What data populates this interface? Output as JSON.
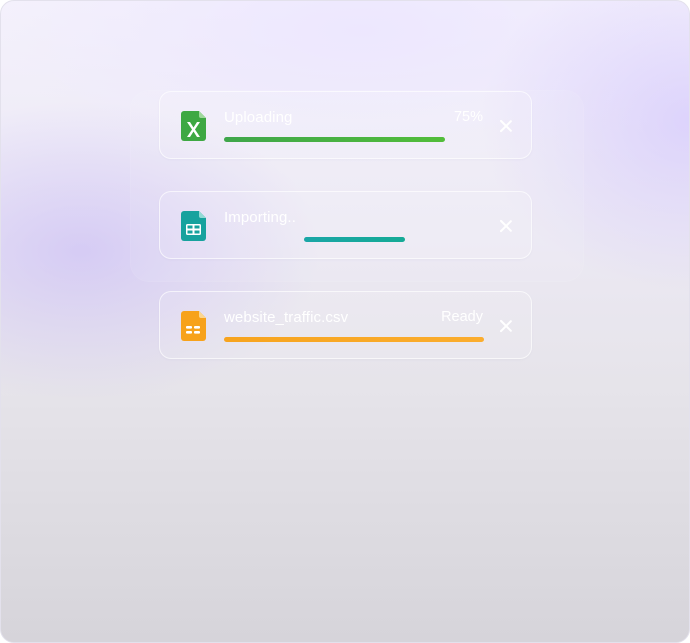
{
  "uploads": [
    {
      "file_icon": "excel-file-icon",
      "title": "Uploading",
      "status": "75%",
      "progress": 0.85,
      "accent": "#46b345"
    },
    {
      "file_icon": "sheets-file-icon",
      "title": "Importing..",
      "status": "",
      "progress": 0.38,
      "progress_offset": 0.31,
      "accent": "#18aaa3"
    },
    {
      "file_icon": "csv-file-icon",
      "title": "website_traffic.csv",
      "status": "Ready",
      "progress": 1.0,
      "accent": "#f9a825"
    }
  ]
}
